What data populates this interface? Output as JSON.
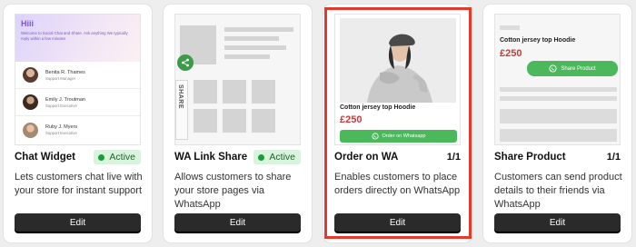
{
  "cards": [
    {
      "title": "Chat Widget",
      "badge": "Active",
      "description": "Lets customers chat live with your store for instant support",
      "edit_label": "Edit",
      "preview": {
        "greeting": "Hiii",
        "message": "Welcome to Social Chat and Share. Ask anything We typically reply within a few minutes",
        "agents": [
          {
            "name": "Benita R. Thames",
            "role": "Support Manager"
          },
          {
            "name": "Emily J. Troutman",
            "role": "Support Executive"
          },
          {
            "name": "Ruby J. Myers",
            "role": "Support Executive"
          }
        ]
      }
    },
    {
      "title": "WA Link Share",
      "badge": "Active",
      "description": "Allows customers to share your store pages via WhatsApp",
      "edit_label": "Edit",
      "preview": {
        "share_tab": "SHARE"
      }
    },
    {
      "title": "Order on WA",
      "pager": "1/1",
      "description": "Enables customers to place orders directly on WhatsApp",
      "edit_label": "Edit",
      "preview": {
        "product_name": "Cotton jersey top Hoodie",
        "price": "£250",
        "button": "Order on Whatsapp"
      }
    },
    {
      "title": "Share Product",
      "pager": "1/1",
      "description": "Customers can send product details to their friends via WhatsApp",
      "edit_label": "Edit",
      "preview": {
        "product_name": "Cotton jersey top Hoodie",
        "price": "£250",
        "button": "Share Product"
      }
    }
  ],
  "colors": {
    "whatsapp_green": "#4cb85c",
    "active_badge_bg": "#d9f4dc",
    "price_red": "#c93a3a",
    "highlight_border": "#e03b2b",
    "edit_button_bg": "#2a2a2a"
  }
}
